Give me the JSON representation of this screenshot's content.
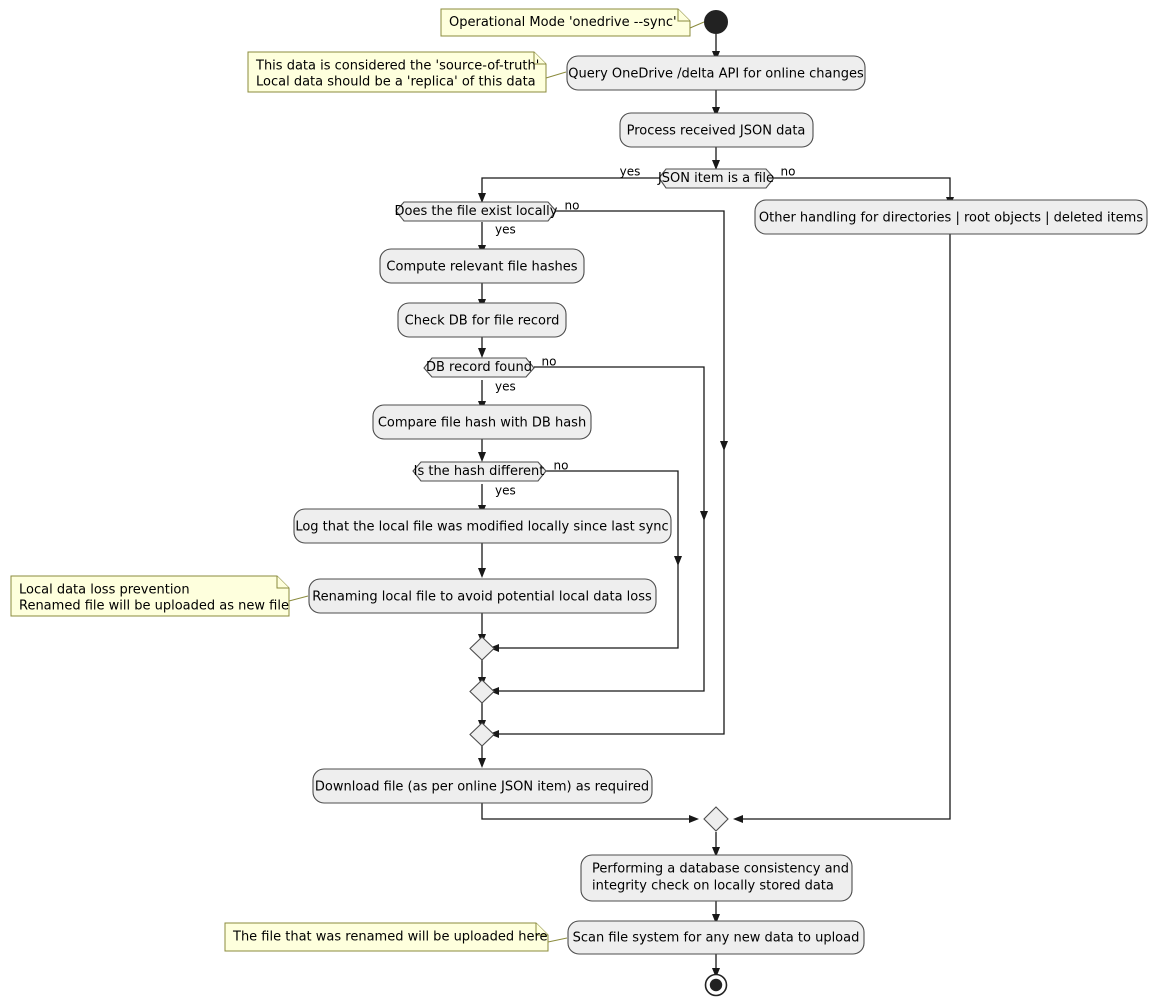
{
  "diagram": {
    "title": "OneDrive sync operational mode activity diagram",
    "type": "activity-diagram",
    "colors": {
      "activity_fill": "#EEEEEE",
      "activity_stroke": "#4D4D4D",
      "note_fill": "#FEFFDD",
      "note_stroke": "#8B8B3D",
      "line": "#181818",
      "terminal": "#222222",
      "background": "#FFFFFF"
    }
  },
  "nodes": {
    "start": {
      "name": "start-node",
      "kind": "initial"
    },
    "end": {
      "name": "end-node",
      "kind": "final"
    },
    "activities": [
      {
        "id": "query_delta",
        "label": "Query OneDrive /delta API for online changes"
      },
      {
        "id": "process_json",
        "label": "Process received JSON data"
      },
      {
        "id": "other_handling",
        "label": "Other handling for directories | root objects | deleted items"
      },
      {
        "id": "compute_hashes",
        "label": "Compute relevant file hashes"
      },
      {
        "id": "check_db",
        "label": "Check DB for file record"
      },
      {
        "id": "compare_hash",
        "label": "Compare file hash with DB hash"
      },
      {
        "id": "log_modified",
        "label": "Log that the local file was modified locally since last sync"
      },
      {
        "id": "rename_local",
        "label": "Renaming local file to avoid potential local data loss"
      },
      {
        "id": "download_file",
        "label": "Download file (as per online JSON item) as required"
      },
      {
        "id": "db_consistency_line1",
        "label": "Performing a database consistency and"
      },
      {
        "id": "db_consistency_line2",
        "label": "integrity check on locally stored data"
      },
      {
        "id": "scan_fs",
        "label": "Scan file system for any new data to upload"
      }
    ],
    "decisions": [
      {
        "id": "json_is_file",
        "label": "JSON item is a file",
        "yes": "yes",
        "no": "no"
      },
      {
        "id": "file_exists_locally",
        "label": "Does the file exist locally",
        "yes": "yes",
        "no": "no"
      },
      {
        "id": "db_record_found",
        "label": "DB record found",
        "yes": "yes",
        "no": "no"
      },
      {
        "id": "hash_different",
        "label": "Is the hash different",
        "yes": "yes",
        "no": "no"
      }
    ],
    "merges": [
      {
        "id": "merge_hash"
      },
      {
        "id": "merge_db"
      },
      {
        "id": "merge_exists"
      },
      {
        "id": "merge_final"
      }
    ]
  },
  "notes": [
    {
      "id": "note_mode",
      "name": "note-operational-mode",
      "lines": [
        "Operational Mode 'onedrive --sync'"
      ],
      "attached_to": "start-node"
    },
    {
      "id": "note_truth",
      "name": "note-source-of-truth",
      "lines": [
        "This data is considered the 'source-of-truth'",
        "Local data should be a 'replica' of this data"
      ],
      "attached_to": "query-delta-activity"
    },
    {
      "id": "note_dataloss",
      "name": "note-local-data-loss-prevention",
      "lines": [
        "Local data loss prevention",
        "Renamed file will be uploaded as new file"
      ],
      "attached_to": "rename-local-activity"
    },
    {
      "id": "note_renamed_upload",
      "name": "note-renamed-file-upload",
      "lines": [
        "The file that was renamed will be uploaded here"
      ],
      "attached_to": "scan-filesystem-activity"
    }
  ],
  "edge_labels": {
    "json_is_file_yes": "yes",
    "json_is_file_no": "no",
    "file_exists_yes": "yes",
    "file_exists_no": "no",
    "db_record_yes": "yes",
    "db_record_no": "no",
    "hash_diff_yes": "yes",
    "hash_diff_no": "no"
  }
}
